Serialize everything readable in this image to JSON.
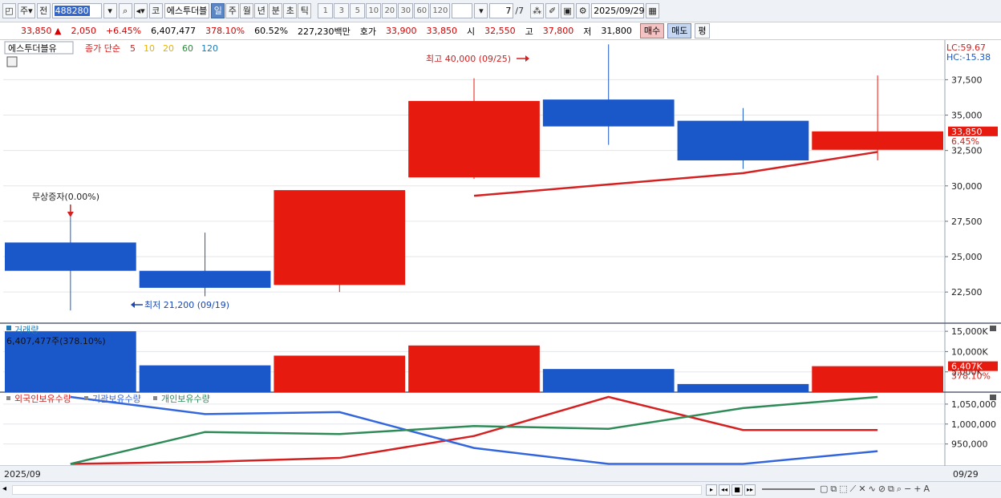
{
  "toolbar": {
    "type_select": "주",
    "scope_button": "전",
    "code": "488280",
    "exchange": "코",
    "stock_name": "에스투더블",
    "periods": [
      "일",
      "주",
      "월",
      "년",
      "분",
      "초",
      "틱"
    ],
    "active_period": "일",
    "intervals": [
      "1",
      "3",
      "5",
      "10",
      "20",
      "30",
      "60",
      "120"
    ],
    "page_count": "7",
    "page_total": "/7",
    "date": "2025/09/29"
  },
  "infobar": {
    "price": "33,850",
    "change_arrow": "▲",
    "change": "2,050",
    "change_pct": "+6.45%",
    "volume": "6,407,477",
    "volume_ratio": "378.10%",
    "turnover": "60.52%",
    "amount": "227,230백만",
    "bid_label": "호가",
    "bid": "33,900",
    "ask": "33,850",
    "open_label": "시",
    "open": "32,550",
    "high_label": "고",
    "high": "37,800",
    "low_label": "저",
    "low": "31,800",
    "buy_button": "매수",
    "sell_button": "매도",
    "avg_button": "평"
  },
  "chart_data": {
    "type": "candlestick",
    "price_panel": {
      "stock_label": "에스투더블유",
      "ma_label": "종가 단순",
      "ma_periods": [
        "5",
        "10",
        "20",
        "60",
        "120"
      ],
      "ma_colors": [
        "#d42020",
        "#e8b400",
        "#e8b400",
        "#2a8a3a",
        "#1f7ab5"
      ],
      "lc_label": "LC:59.67",
      "hc_label": "HC:-15.38",
      "y_ticks": [
        "37,500",
        "35,000",
        "32,500",
        "30,000",
        "27,500",
        "25,000",
        "22,500"
      ],
      "y_tick_values": [
        37500,
        35000,
        32500,
        30000,
        27500,
        25000,
        22500
      ],
      "ylim": [
        20300,
        40300
      ],
      "candles": [
        {
          "x": "1",
          "open": 26000,
          "high": 27800,
          "low": 21200,
          "close": 24000,
          "color": "#1a57c9"
        },
        {
          "x": "2",
          "open": 24000,
          "high": 26700,
          "low": 22200,
          "close": 22800,
          "color": "#1a57c9"
        },
        {
          "x": "3",
          "open": 23000,
          "high": 29500,
          "low": 22500,
          "close": 29700,
          "color": "#e61a0f"
        },
        {
          "x": "4",
          "open": 30600,
          "high": 37600,
          "low": 30500,
          "close": 36000,
          "color": "#e61a0f"
        },
        {
          "x": "5",
          "open": 36100,
          "high": 40000,
          "low": 32900,
          "close": 34200,
          "color": "#1a57c9"
        },
        {
          "x": "6",
          "open": 34600,
          "high": 35500,
          "low": 31200,
          "close": 31800,
          "color": "#1a57c9"
        },
        {
          "x": "7",
          "open": 32550,
          "high": 37800,
          "low": 31800,
          "close": 33850,
          "color": "#e61a0f"
        }
      ],
      "ma5_line": [
        29300,
        30100,
        30900,
        32400
      ],
      "high_annotation": "최고 40,000 (09/25)",
      "low_annotation": "최저 21,200 (09/19)",
      "event_annotation": "무상증자(0.00%)",
      "last_price_tag": "33,850",
      "last_pct_tag": "6.45%"
    },
    "volume_panel": {
      "label": "거래량",
      "info": "6,407,477주(378.10%)",
      "y_ticks": [
        "15,000K",
        "10,000K",
        "5,000K"
      ],
      "y_tick_values": [
        15000,
        10000,
        5000
      ],
      "ylim": [
        0,
        17000
      ],
      "values": [
        15000,
        6600,
        9000,
        11500,
        5700,
        2000,
        6400
      ],
      "colors": [
        "#1a57c9",
        "#1a57c9",
        "#e61a0f",
        "#e61a0f",
        "#1a57c9",
        "#1a57c9",
        "#e61a0f"
      ],
      "last_tag": "6,407K",
      "last_pct_tag": "378.10%"
    },
    "holdings_panel": {
      "legend": [
        {
          "name": "외국인보유수량",
          "color": "#d42020"
        },
        {
          "name": "기관보유수량",
          "color": "#3366dd"
        },
        {
          "name": "개인보유수량",
          "color": "#2e8b57"
        }
      ],
      "y_ticks": [
        "1,050,000",
        "1,000,000",
        "950,000"
      ],
      "y_tick_values": [
        1050000,
        1000000,
        950000
      ],
      "ylim": [
        895000,
        1080000
      ],
      "series": [
        {
          "name": "외국인보유수량",
          "values": [
            900000,
            905000,
            915000,
            970000,
            1068000,
            985000,
            985000
          ]
        },
        {
          "name": "기관보유수량",
          "values": [
            1068000,
            1025000,
            1030000,
            940000,
            900000,
            900000,
            932000
          ]
        },
        {
          "name": "개인보유수량",
          "values": [
            900000,
            980000,
            975000,
            995000,
            988000,
            1040000,
            1068000
          ]
        }
      ]
    },
    "x_start_label": "2025/09",
    "x_end_label": "09/29"
  }
}
